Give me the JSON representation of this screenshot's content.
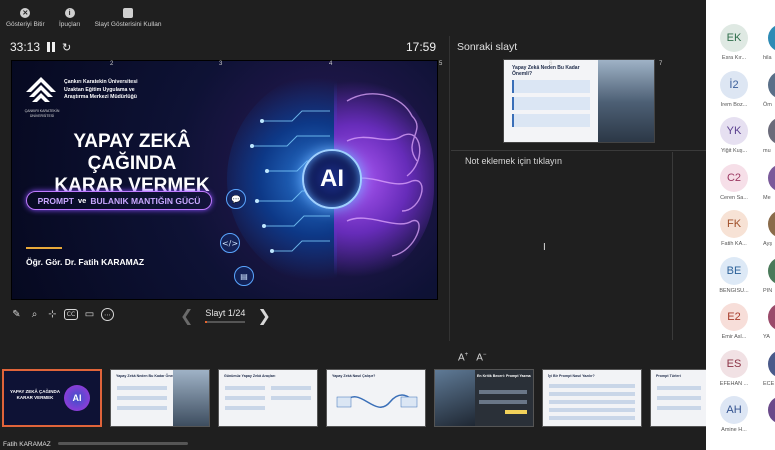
{
  "toolbar": {
    "end_show": "Gösteriyi Bitir",
    "tips": "İpuçları",
    "use_slideshow": "Slayt Gösterisini Kullan"
  },
  "timer": {
    "elapsed": "33:13",
    "clock": "17:59"
  },
  "main_slide": {
    "university": [
      "Çankırı Karatekin Üniversitesi",
      "Uzaktan Eğitim Uygulama ve",
      "Araştırma Merkezi Müdürlüğü"
    ],
    "logo_caption": "ÇANKIRI KARATEKİN ÜNİVERSİTESİ",
    "title_line1": "YAPAY ZEKÂ ÇAĞINDA",
    "title_line2": "KARAR VERMEK",
    "subtitle_a": "PROMPT",
    "subtitle_ve": "ve",
    "subtitle_b": "BULANIK MANTIĞIN GÜCÜ",
    "author": "Öğr. Gör. Dr. Fatih KARAMAZ",
    "ai_label": "AI"
  },
  "navigation": {
    "slide_label": "Slayt 1/24",
    "progress": 0.042
  },
  "next_slide": {
    "label": "Sonraki slayt",
    "title": "Yapay Zekâ Neden Bu Kadar Önemli?"
  },
  "notes": {
    "placeholder": "Not eklemek için tıklayın"
  },
  "filmstrip": {
    "numbers": [
      "2",
      "3",
      "4",
      "5",
      "6",
      "7"
    ],
    "thumb_titles": [
      "Yapay Zekâ Neden Bu Kadar Önemli?",
      "Günümüz Yapay Zekâ Araçları",
      "Yapay Zekâ Nasıl Çalışır?",
      "En Kritik Beceri: Prompt Yazma",
      "İyi Bir Prompt Nasıl Yazılır?",
      "Prompt Türleri"
    ],
    "first_title": "YAPAY ZEKÂ ÇAĞINDA KARAR VERMEK",
    "first_ai": "AI"
  },
  "camera_name": "Fatih KARAMAZ",
  "participants": [
    {
      "initials": "EK",
      "name": "Esra Kır...",
      "bg": "#dfe9e3",
      "fg": "#2f6e4b"
    },
    {
      "initials": "İ2",
      "name": "İrem Boz...",
      "bg": "#dde6f3",
      "fg": "#3a5e9a"
    },
    {
      "initials": "YK",
      "name": "Yiğit Kuş...",
      "bg": "#e6e0f1",
      "fg": "#5b3f8f"
    },
    {
      "initials": "C2",
      "name": "Ceren Sa...",
      "bg": "#f6dfe8",
      "fg": "#9c3862"
    },
    {
      "initials": "FK",
      "name": "Fatih KA...",
      "bg": "#f7e2d5",
      "fg": "#a0502a"
    },
    {
      "initials": "BE",
      "name": "BENGİSU...",
      "bg": "#dde9f6",
      "fg": "#2d6299"
    },
    {
      "initials": "E2",
      "name": "Emir Asl...",
      "bg": "#f7ded9",
      "fg": "#a63b2a"
    },
    {
      "initials": "ES",
      "name": "EFEHAN ...",
      "bg": "#f1e1e4",
      "fg": "#8c3346"
    },
    {
      "initials": "AH",
      "name": "Amine H...",
      "bg": "#dde6f4",
      "fg": "#33528f"
    }
  ],
  "edge_participants": [
    "hila",
    "Öm",
    "mu",
    "Me",
    "Ayş",
    "PIN",
    "YA",
    "ECE",
    ""
  ],
  "edge_colors": [
    "#2e8bb5",
    "#5a6f88",
    "#6b6b7a",
    "#7a5a9a",
    "#8a6b4a",
    "#4a7a5a",
    "#9a4a6a",
    "#4a5a8a",
    "#6a4a8a"
  ]
}
